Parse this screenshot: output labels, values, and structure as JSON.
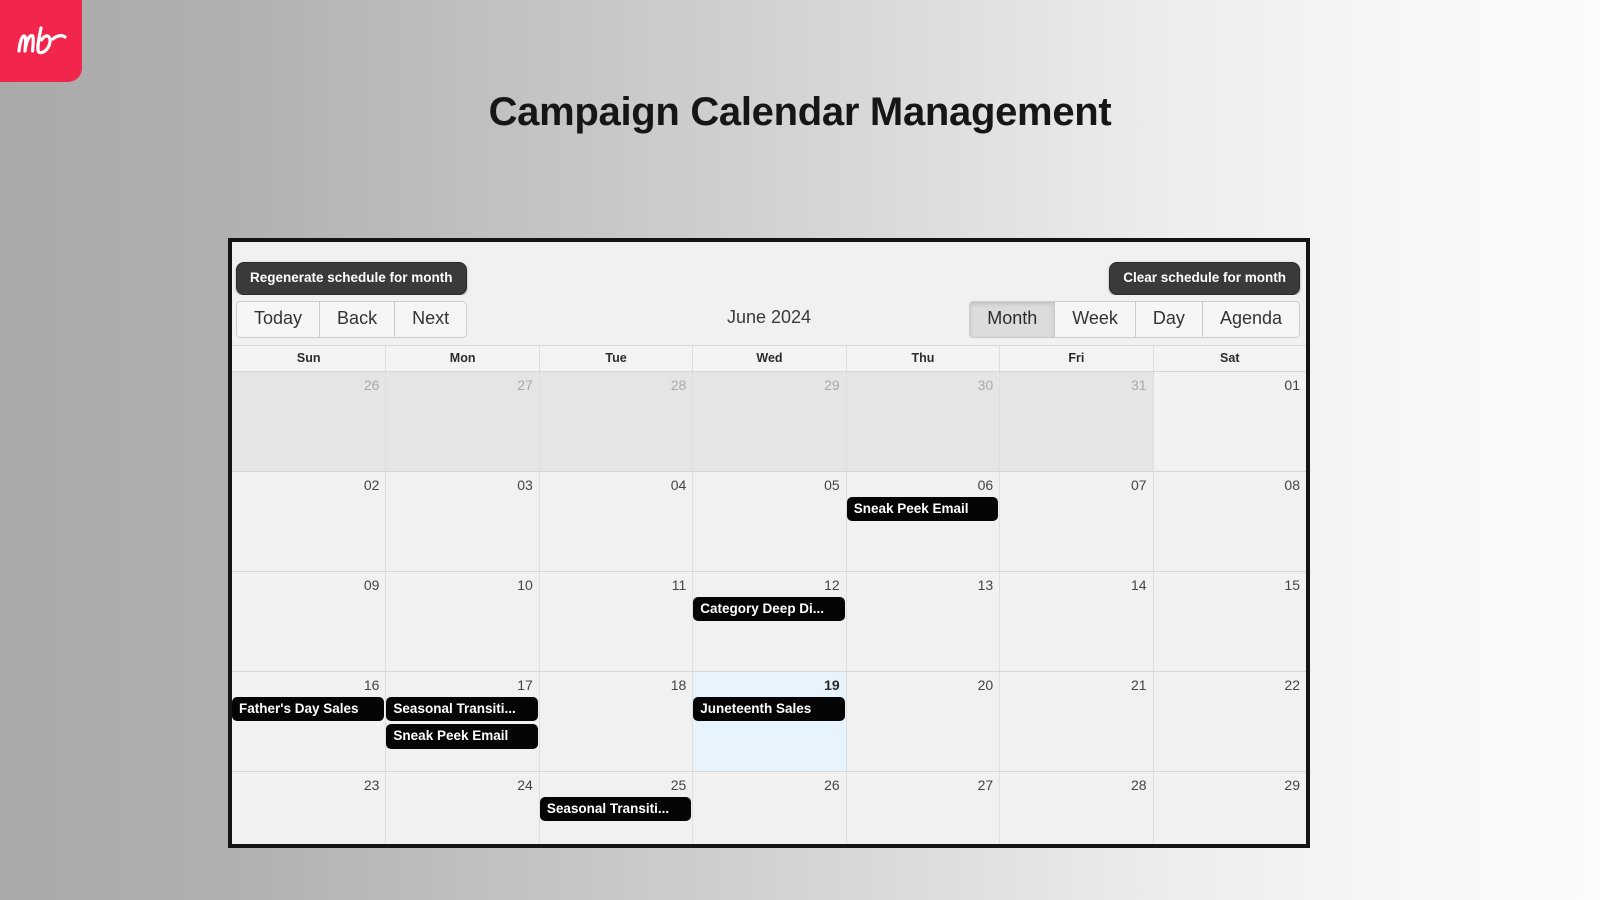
{
  "logo": {
    "text": "mb",
    "color": "#f2254c"
  },
  "page": {
    "title": "Campaign Calendar Management"
  },
  "actions": {
    "regenerate_label": "Regenerate schedule for month",
    "clear_label": "Clear schedule for month"
  },
  "toolbar": {
    "nav": [
      {
        "label": "Today"
      },
      {
        "label": "Back"
      },
      {
        "label": "Next"
      }
    ],
    "month_label": "June 2024",
    "views": [
      {
        "label": "Month",
        "active": true
      },
      {
        "label": "Week",
        "active": false
      },
      {
        "label": "Day",
        "active": false
      },
      {
        "label": "Agenda",
        "active": false
      }
    ]
  },
  "calendar": {
    "weekdays": [
      "Sun",
      "Mon",
      "Tue",
      "Wed",
      "Thu",
      "Fri",
      "Sat"
    ],
    "weeks": [
      [
        {
          "num": "26",
          "off": true,
          "today": false,
          "events": []
        },
        {
          "num": "27",
          "off": true,
          "today": false,
          "events": []
        },
        {
          "num": "28",
          "off": true,
          "today": false,
          "events": []
        },
        {
          "num": "29",
          "off": true,
          "today": false,
          "events": []
        },
        {
          "num": "30",
          "off": true,
          "today": false,
          "events": []
        },
        {
          "num": "31",
          "off": true,
          "today": false,
          "events": []
        },
        {
          "num": "01",
          "off": false,
          "today": false,
          "events": []
        }
      ],
      [
        {
          "num": "02",
          "off": false,
          "today": false,
          "events": []
        },
        {
          "num": "03",
          "off": false,
          "today": false,
          "events": []
        },
        {
          "num": "04",
          "off": false,
          "today": false,
          "events": []
        },
        {
          "num": "05",
          "off": false,
          "today": false,
          "events": []
        },
        {
          "num": "06",
          "off": false,
          "today": false,
          "events": [
            "Sneak Peek Email"
          ]
        },
        {
          "num": "07",
          "off": false,
          "today": false,
          "events": []
        },
        {
          "num": "08",
          "off": false,
          "today": false,
          "events": []
        }
      ],
      [
        {
          "num": "09",
          "off": false,
          "today": false,
          "events": []
        },
        {
          "num": "10",
          "off": false,
          "today": false,
          "events": []
        },
        {
          "num": "11",
          "off": false,
          "today": false,
          "events": []
        },
        {
          "num": "12",
          "off": false,
          "today": false,
          "events": [
            "Category Deep Di..."
          ]
        },
        {
          "num": "13",
          "off": false,
          "today": false,
          "events": []
        },
        {
          "num": "14",
          "off": false,
          "today": false,
          "events": []
        },
        {
          "num": "15",
          "off": false,
          "today": false,
          "events": []
        }
      ],
      [
        {
          "num": "16",
          "off": false,
          "today": false,
          "events": [
            "Father's Day Sales"
          ]
        },
        {
          "num": "17",
          "off": false,
          "today": false,
          "events": [
            "Seasonal Transiti...",
            "Sneak Peek Email"
          ]
        },
        {
          "num": "18",
          "off": false,
          "today": false,
          "events": []
        },
        {
          "num": "19",
          "off": false,
          "today": true,
          "events": [
            "Juneteenth Sales"
          ]
        },
        {
          "num": "20",
          "off": false,
          "today": false,
          "events": []
        },
        {
          "num": "21",
          "off": false,
          "today": false,
          "events": []
        },
        {
          "num": "22",
          "off": false,
          "today": false,
          "events": []
        }
      ],
      [
        {
          "num": "23",
          "off": false,
          "today": false,
          "events": []
        },
        {
          "num": "24",
          "off": false,
          "today": false,
          "events": []
        },
        {
          "num": "25",
          "off": false,
          "today": false,
          "events": [
            "Seasonal Transiti..."
          ]
        },
        {
          "num": "26",
          "off": false,
          "today": false,
          "events": []
        },
        {
          "num": "27",
          "off": false,
          "today": false,
          "events": []
        },
        {
          "num": "28",
          "off": false,
          "today": false,
          "events": []
        },
        {
          "num": "29",
          "off": false,
          "today": false,
          "events": []
        }
      ]
    ]
  }
}
